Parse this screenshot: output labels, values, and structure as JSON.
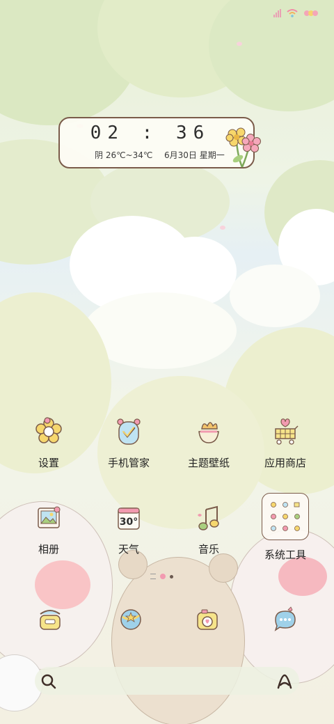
{
  "clock": {
    "time": "02 : 36",
    "weather": "阴 26℃~34℃",
    "date": "6月30日 星期一"
  },
  "apps_row1": [
    {
      "label": "设置",
      "icon": "settings-flower-icon"
    },
    {
      "label": "手机管家",
      "icon": "phone-manager-icon"
    },
    {
      "label": "主题壁纸",
      "icon": "theme-wallpaper-icon"
    },
    {
      "label": "应用商店",
      "icon": "app-store-cart-icon"
    }
  ],
  "apps_row2": [
    {
      "label": "相册",
      "icon": "gallery-icon"
    },
    {
      "label": "天气",
      "icon": "weather-calendar-icon"
    },
    {
      "label": "音乐",
      "icon": "music-note-icon"
    },
    {
      "label": "系统工具",
      "icon": "folder-icon"
    }
  ],
  "weather_icon_text": "30°",
  "dock": [
    {
      "icon": "phone-icon"
    },
    {
      "icon": "browser-globe-icon"
    },
    {
      "icon": "camera-icon"
    },
    {
      "icon": "messages-icon"
    }
  ],
  "search": {
    "icon": "search-icon",
    "assistant_icon": "assistant-icon"
  },
  "colors": {
    "outline": "#7a5b4a",
    "accent_pink": "#f29ab0",
    "accent_yellow": "#f6dc72",
    "accent_blue": "#9fd1e9"
  }
}
